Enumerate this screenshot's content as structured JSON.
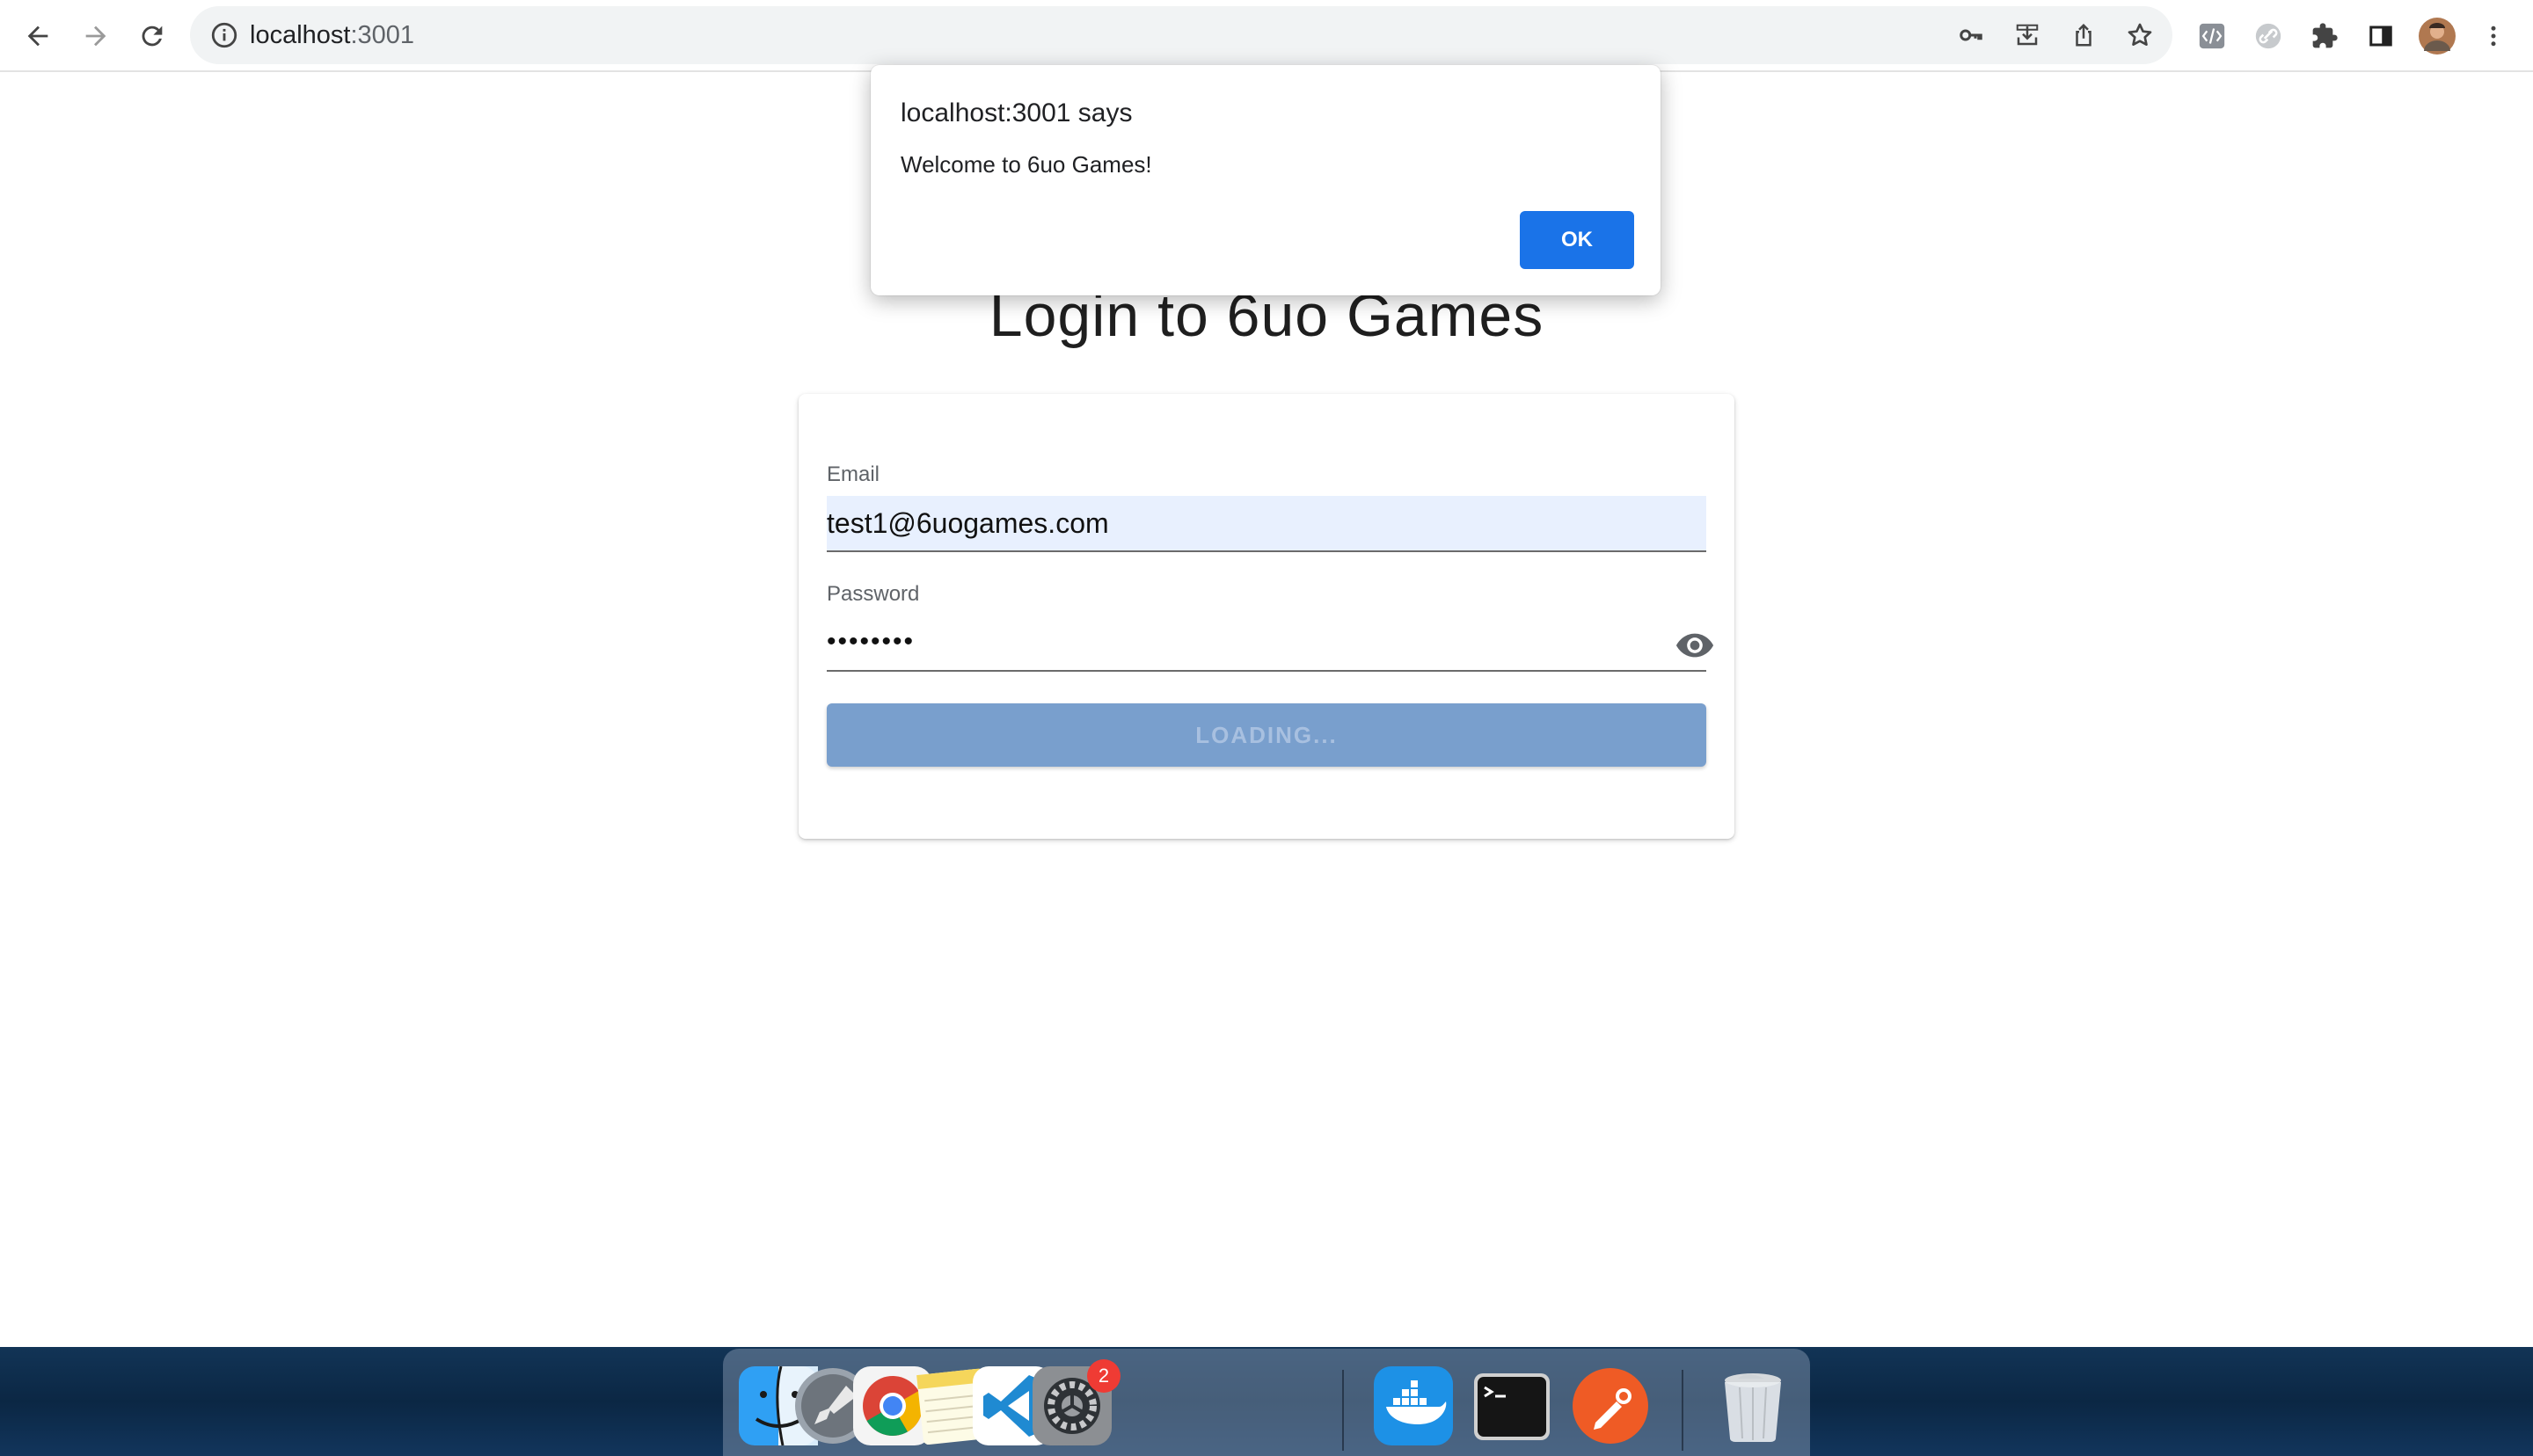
{
  "browser": {
    "url_host": "localhost",
    "url_rest": ":3001",
    "icons": [
      "back-arrow-icon",
      "forward-arrow-icon",
      "reload-icon",
      "info-icon",
      "key-icon",
      "install-icon",
      "share-icon",
      "star-icon",
      "devtools-extension-icon",
      "link-extension-icon",
      "puzzle-icon",
      "side-panel-icon",
      "profile-avatar",
      "kebab-menu-icon"
    ]
  },
  "page": {
    "title": "Login to 6uo Games",
    "email": {
      "label": "Email",
      "value": "test1@6uogames.com"
    },
    "password": {
      "label": "Password",
      "value": "••••••••"
    },
    "submit_label": "LOADING..."
  },
  "dialog": {
    "title": "localhost:3001 says",
    "message": "Welcome to 6uo Games!",
    "ok_label": "OK"
  },
  "dock": {
    "apps": [
      "Finder",
      "Launchpad",
      "Google Chrome",
      "Notes",
      "Visual Studio Code",
      "System Preferences",
      "Docker",
      "Terminal",
      "Postman",
      "Trash"
    ],
    "system_prefs_badge": "2"
  },
  "colors": {
    "accent": "#1a73e8",
    "button_disabled": "#799fcd",
    "autofill": "#e8f0fe"
  }
}
